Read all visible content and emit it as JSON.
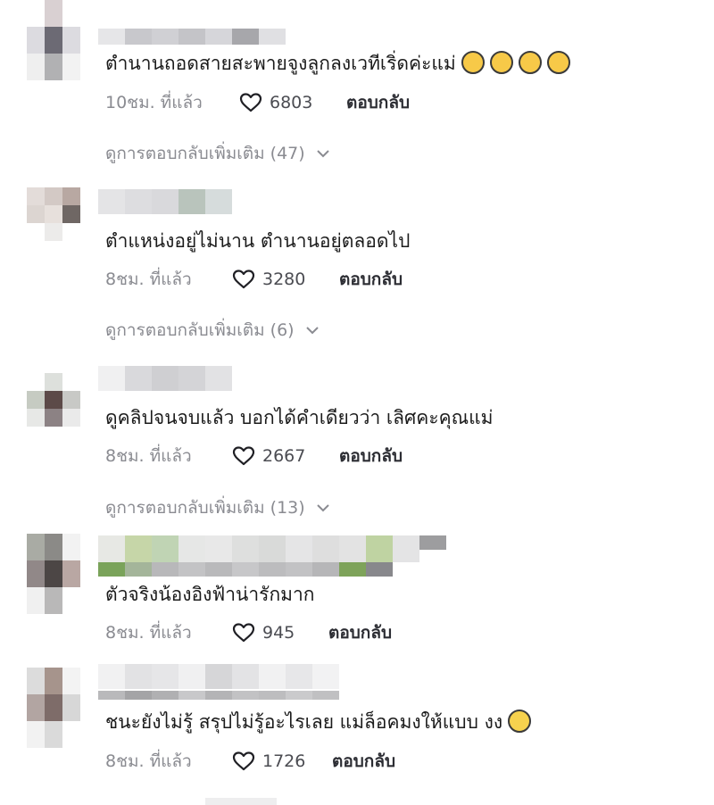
{
  "comments": [
    {
      "text": "ตำนานถอดสายสะพายจูงลูกลงเวทีเริ่ดค่ะแม่",
      "emoji": [
        "laugh-cry-emoji",
        "laugh-cry-emoji",
        "laugh-cry-emoji",
        "laugh-cry-emoji"
      ],
      "time": "10ชม. ที่แล้ว",
      "likes": "6803",
      "reply_label": "ตอบกลับ",
      "more_replies": "ดูการตอบกลับเพิ่มเติม (47)"
    },
    {
      "text": "ตำแหน่งอยู่ไม่นาน ตำนานอยู่ตลอดไป",
      "time": "8ชม. ที่แล้ว",
      "likes": "3280",
      "reply_label": "ตอบกลับ",
      "more_replies": "ดูการตอบกลับเพิ่มเติม (6)"
    },
    {
      "text": "ดูคลิปจนจบแล้ว บอกได้คำเดียวว่า เลิศคะคุณแม่",
      "time": "8ชม. ที่แล้ว",
      "likes": "2667",
      "reply_label": "ตอบกลับ",
      "more_replies": "ดูการตอบกลับเพิ่มเติม (13)"
    },
    {
      "text": "ตัวจริงน้องอิงฟ้าน่ารักมาก",
      "time": "8ชม. ที่แล้ว",
      "likes": "945",
      "reply_label": "ตอบกลับ"
    },
    {
      "text": "ชนะยังไม่รู้ สรุปไม่รู้อะไรเลย แม่ล็อคมงให้แบบ งง",
      "emoji": [
        "flushed-emoji"
      ],
      "time": "8ชม. ที่แล้ว",
      "likes": "1726",
      "reply_label": "ตอบกลับ"
    }
  ],
  "colors": {
    "meta_text": "#8a8b91",
    "reply_text": "#2c2d33"
  }
}
